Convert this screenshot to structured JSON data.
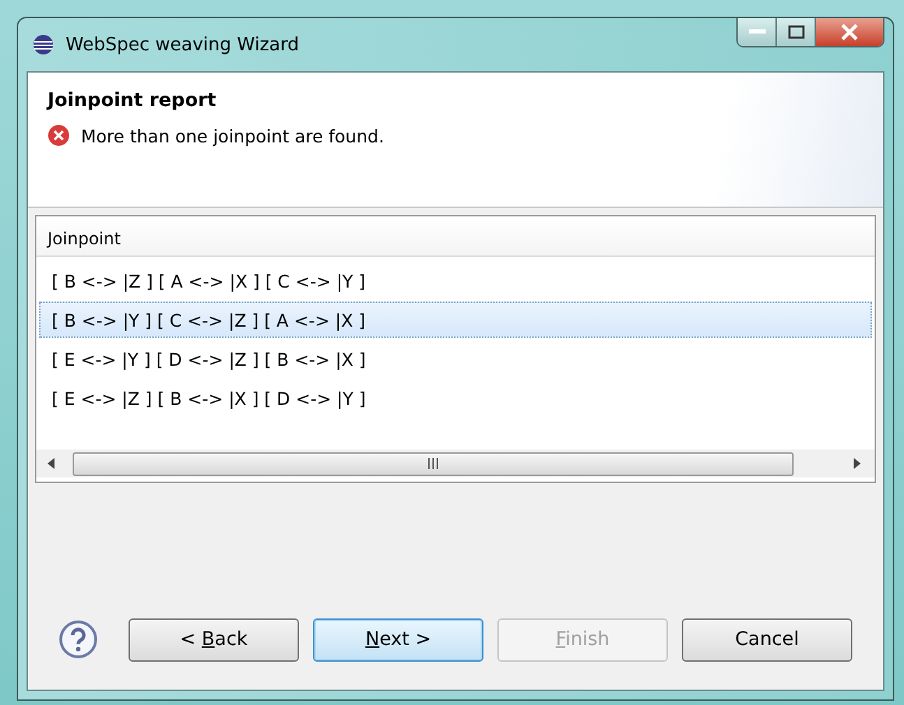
{
  "window": {
    "title": "WebSpec weaving Wizard"
  },
  "header": {
    "title": "Joinpoint report",
    "message": {
      "kind": "error",
      "text": "More than one joinpoint are found."
    }
  },
  "table": {
    "columns": [
      "Joinpoint"
    ],
    "rows": [
      {
        "cells": [
          "[ B <-> |Z ] [ A <-> |X ] [ C <-> |Y ]"
        ],
        "selected": false
      },
      {
        "cells": [
          "[ B <-> |Y ] [ C <-> |Z ] [ A <-> |X ]"
        ],
        "selected": true
      },
      {
        "cells": [
          "[ E <-> |Y ] [ D <-> |Z ] [ B <-> |X ]"
        ],
        "selected": false
      },
      {
        "cells": [
          "[ E <-> |Z ] [ B <-> |X ] [ D <-> |Y ]"
        ],
        "selected": false
      }
    ]
  },
  "buttons": [
    {
      "before": "< ",
      "mnemonic": "B",
      "after": "ack",
      "default": false,
      "disabled": false
    },
    {
      "mnemonic": "N",
      "after": "ext >",
      "default": true,
      "disabled": false
    },
    {
      "mnemonic": "F",
      "after": "inish",
      "default": false,
      "disabled": true
    },
    {
      "after": "Cancel",
      "default": false,
      "disabled": false
    }
  ]
}
